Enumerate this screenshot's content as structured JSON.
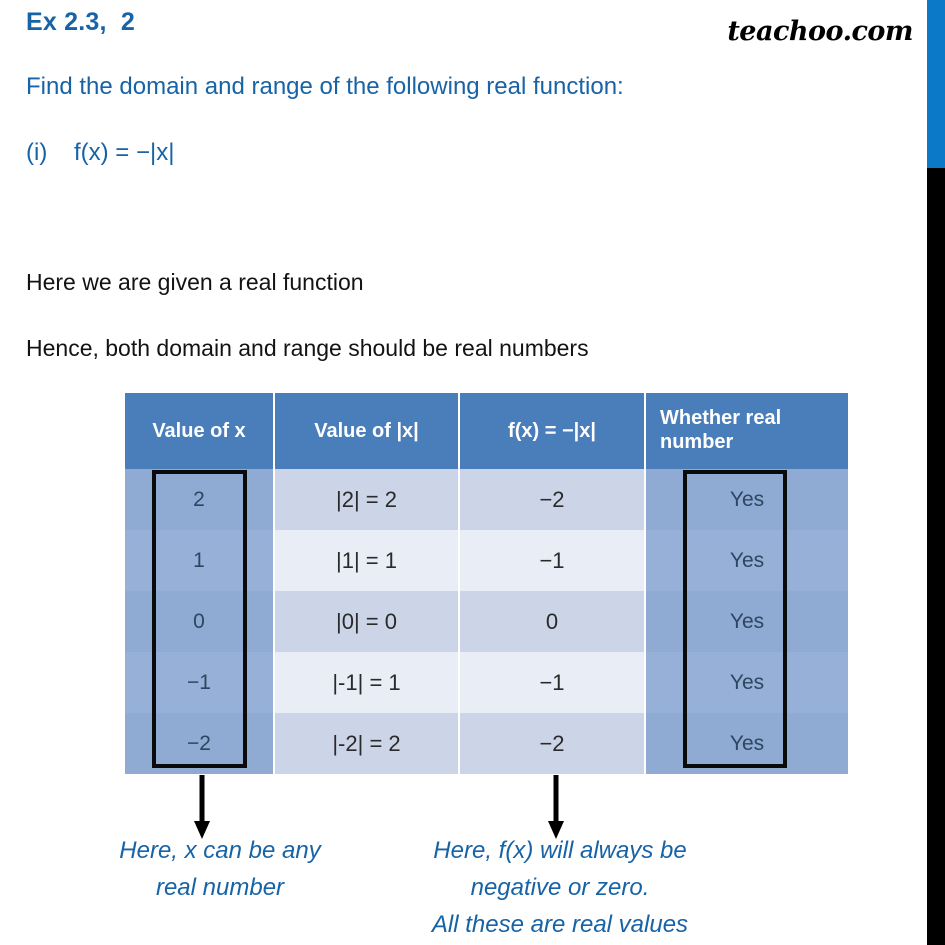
{
  "header": {
    "exercise_title": "Ex 2.3,  2",
    "brand": "teachoo.com",
    "question": "Find the domain and range of the following real function:",
    "sub_question": "(i)    f(x) = −|x|"
  },
  "body": {
    "line1": "Here we are given a real function",
    "line2": "Hence, both domain and range should be real numbers"
  },
  "table": {
    "headers": {
      "col1": "Value of x",
      "col2": "Value of |x|",
      "col3": "f(x) = −|x|",
      "col4": "Whether real\nnumber"
    },
    "rows": [
      {
        "x": "2",
        "abs": "|2| = 2",
        "fx": "−2",
        "real": "Yes"
      },
      {
        "x": "1",
        "abs": "|1| = 1",
        "fx": "−1",
        "real": "Yes"
      },
      {
        "x": "0",
        "abs": "|0| = 0",
        "fx": "0",
        "real": "Yes"
      },
      {
        "x": "−1",
        "abs": "|-1| = 1",
        "fx": "−1",
        "real": "Yes"
      },
      {
        "x": "−2",
        "abs": "|-2| = 2",
        "fx": "−2",
        "real": "Yes"
      }
    ]
  },
  "notes": {
    "left": "Here, x can be any\nreal number",
    "right": "Here, f(x) will always be\nnegative or zero.\nAll these are real values"
  },
  "colors": {
    "accent_blue": "#1763A6",
    "header_blue": "#4A7EBB",
    "row_odd": "#CBD5E7",
    "row_even": "#E8EDF6",
    "highlight": "#8FAAD3",
    "edge_blue": "#0B79C8"
  }
}
